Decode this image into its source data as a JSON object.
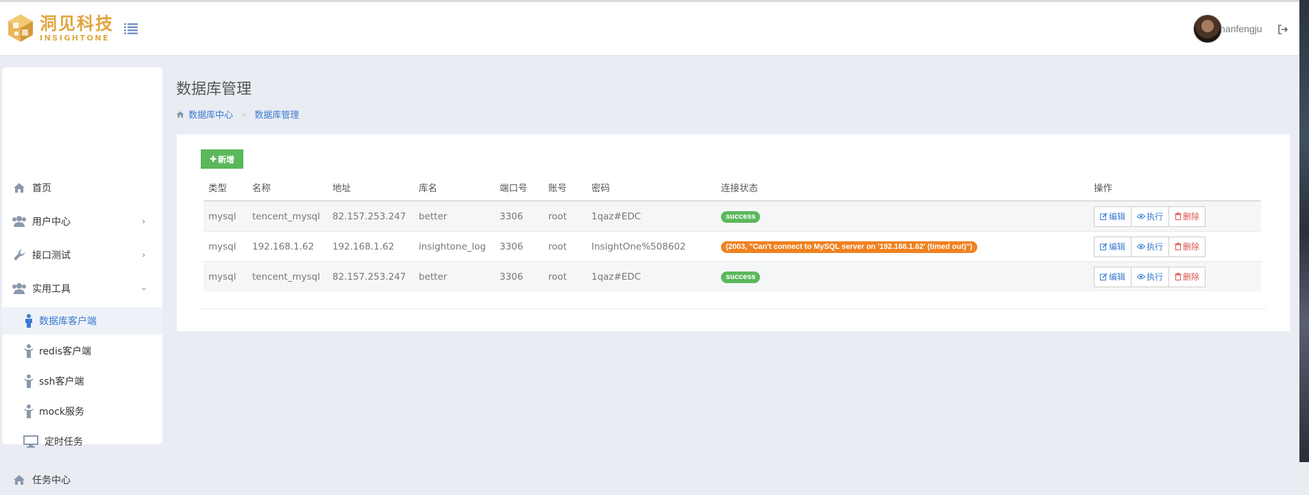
{
  "header": {
    "logo_cn": "洞见科技",
    "logo_en": "INSIGHTONE",
    "username": "hanfengju"
  },
  "sidebar": {
    "items": [
      {
        "label": "首页",
        "icon": "home-icon"
      },
      {
        "label": "用户中心",
        "icon": "users-icon"
      },
      {
        "label": "接口测试",
        "icon": "wrench-icon"
      },
      {
        "label": "实用工具",
        "icon": "users-icon"
      },
      {
        "label": "任务中心",
        "icon": "home-icon"
      }
    ],
    "subitems": [
      {
        "label": "数据库客户端",
        "icon": "person-icon",
        "active": true
      },
      {
        "label": "redis客户端",
        "icon": "person-icon"
      },
      {
        "label": "ssh客户端",
        "icon": "person-icon"
      },
      {
        "label": "mock服务",
        "icon": "person-icon"
      },
      {
        "label": "定时任务",
        "icon": "monitor-icon"
      }
    ]
  },
  "page": {
    "title": "数据库管理",
    "breadcrumb": [
      "数据库中心",
      "数据库管理"
    ],
    "add_label": "新增"
  },
  "table": {
    "headers": [
      "类型",
      "名称",
      "地址",
      "库名",
      "端口号",
      "账号",
      "密码",
      "连接状态",
      "操作"
    ],
    "rows": [
      {
        "type": "mysql",
        "name": "tencent_mysql",
        "host": "82.157.253.247",
        "db": "better",
        "port": "3306",
        "user": "root",
        "password": "1qaz#EDC",
        "status": "success",
        "status_kind": "success"
      },
      {
        "type": "mysql",
        "name": "192.168.1.62",
        "host": "192.168.1.62",
        "db": "insightone_log",
        "port": "3306",
        "user": "root",
        "password": "InsightOne%508602",
        "status": "(2003, \"Can't connect to MySQL server on '192.168.1.62' (timed out)\")",
        "status_kind": "warning"
      },
      {
        "type": "mysql",
        "name": "tencent_mysql",
        "host": "82.157.253.247",
        "db": "better",
        "port": "3306",
        "user": "root",
        "password": "1qaz#EDC",
        "status": "success",
        "status_kind": "success"
      }
    ],
    "actions": {
      "edit": "编辑",
      "run": "执行",
      "delete": "删除"
    }
  },
  "colors": {
    "brand": "#e0a640",
    "link": "#3a7bd0",
    "success": "#5cb85c",
    "warning": "#f0811f",
    "danger": "#d9534f"
  }
}
